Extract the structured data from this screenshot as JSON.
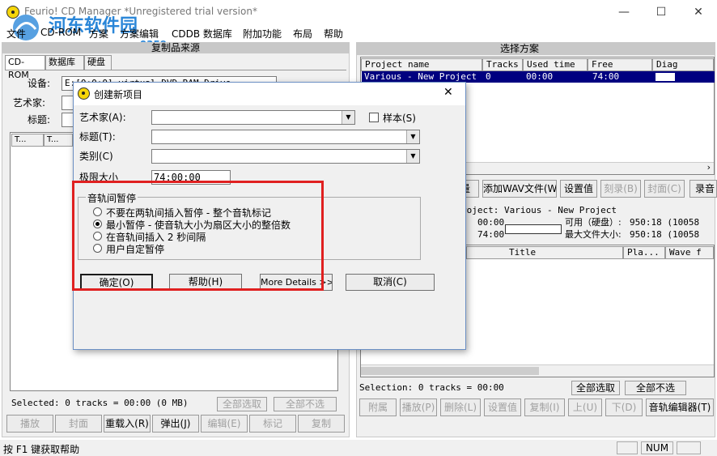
{
  "window": {
    "title": "Feurio! CD Manager *Unregistered trial version*",
    "minimize": "—",
    "maximize": "☐",
    "close": "✕"
  },
  "watermark": {
    "text": "河东软件园",
    "url": "www.pc0359.cn"
  },
  "menu": [
    "文件",
    "CD-ROM",
    "方案",
    "方案编辑",
    "CDDB 数据库",
    "附加功能",
    "布局",
    "帮助"
  ],
  "left": {
    "header": "复制品来源",
    "tabs": [
      "CD-ROM",
      "数据库",
      "硬盘"
    ],
    "device_label": "设备:",
    "device_value": "E:[0:0:0] virtual DVD-RAM Drive",
    "artist_label": "艺术家:",
    "title_label": "标题:",
    "col1": "T...",
    "col2": "T...",
    "selected_text": "Selected: 0 tracks = 00:00 (0 MB)",
    "select_all": "全部选取",
    "deselect_all": "全部不选",
    "buttons": [
      "播放",
      "封面",
      "重载入(R)",
      "弹出(J)",
      "编辑(E)",
      "标记",
      "复制"
    ]
  },
  "right": {
    "header": "选择方案",
    "columns": [
      "Project name",
      "Tracks",
      "Used time",
      "Free",
      "Diag"
    ],
    "row": {
      "name": "Various - New Project",
      "tracks": "0",
      "used": "00:00",
      "free": "74:00"
    },
    "toolbar": [
      "量",
      "添加WAV文件(W)",
      "设置值",
      "刻录(B)",
      "封面(C)",
      "录音"
    ],
    "project_label": "roject: Various - New Project",
    "time1": "00:00",
    "time2": "74:00",
    "avail_label": "可用（硬盘）:",
    "avail_value": "950:18  (10058",
    "maxfile_label": "最大文件大小:",
    "maxfile_value": "950:18  (10058",
    "track_cols": [
      "Title",
      "Pla...",
      "Wave f"
    ],
    "selection_text": "Selection: 0 tracks = 00:00",
    "select_all": "全部选取",
    "deselect_all": "全部不选",
    "bottom_buttons": [
      "附属",
      "播放(P)",
      "删除(L)",
      "设置值",
      "复制(I)",
      "上(U)",
      "下(D)",
      "音轨编辑器(T)"
    ]
  },
  "statusbar": {
    "help": "按 F1 键获取帮助",
    "num": "NUM"
  },
  "dialog": {
    "title": "创建新项目",
    "close": "✕",
    "artist_label": "艺术家(A):",
    "sampler_label": "样本(S)",
    "title_label": "标题(T):",
    "category_label": "类别(C)",
    "limit_label": "极限大小",
    "limit_value": "74:00:00",
    "pause_group": "音轨间暂停",
    "options": [
      "不要在两轨间插入暂停 - 整个音轨标记",
      "最小暂停 - 使音轨大小为扇区大小的整倍数",
      "在音轨间插入 2 秒间隔",
      "用户自定暂停"
    ],
    "selected_option": 1,
    "ok": "确定(O)",
    "help": "帮助(H)",
    "more": "More Details >>",
    "cancel": "取消(C)"
  },
  "colors": {
    "selection": "#000080",
    "highlight_box": "#e02020",
    "panel_header": "#c8c8c8"
  }
}
